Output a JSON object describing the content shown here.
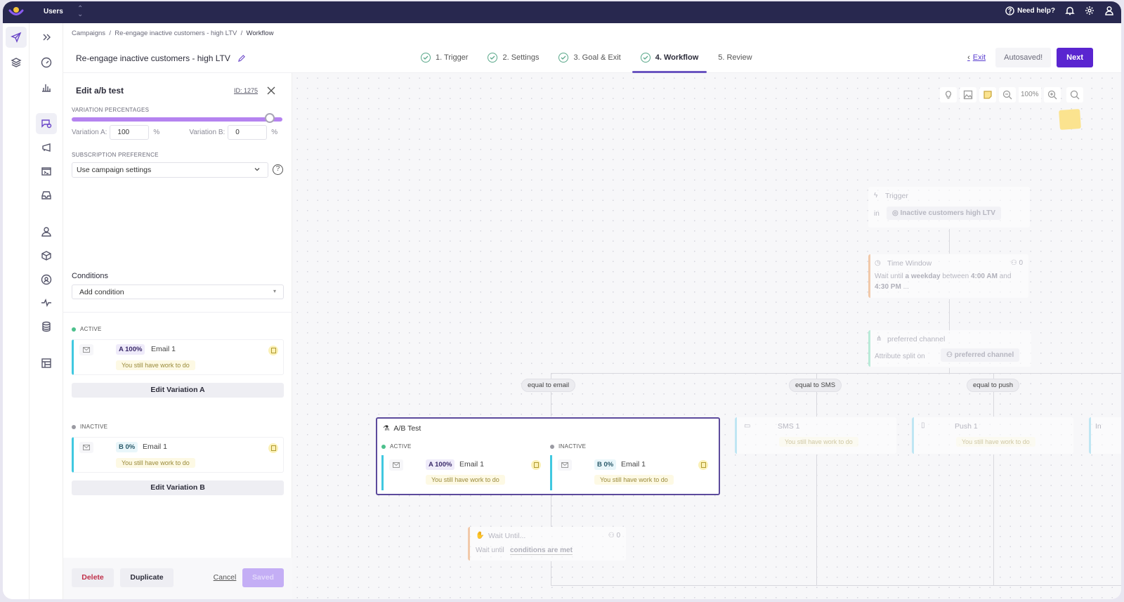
{
  "topbar": {
    "app_name": "Users",
    "help_label": "Need help?",
    "icons": [
      "help-circle-icon",
      "bell-icon",
      "gear-icon",
      "user-icon"
    ]
  },
  "rail_primary": [
    {
      "icon": "paper-plane-icon",
      "active": true
    },
    {
      "icon": "layers-icon",
      "active": false
    }
  ],
  "rail_secondary": [
    {
      "icon": "double-chevron-right-icon"
    },
    {
      "icon": "gauge-icon"
    },
    {
      "icon": "bar-chart-icon"
    },
    {
      "icon": "campaign-chat-icon",
      "active": true
    },
    {
      "icon": "megaphone-icon"
    },
    {
      "icon": "terminal-icon"
    },
    {
      "icon": "inbox-icon"
    },
    {
      "icon": "person-icon"
    },
    {
      "icon": "cube-icon"
    },
    {
      "icon": "user-circle-icon"
    },
    {
      "icon": "activity-icon"
    },
    {
      "icon": "database-icon"
    },
    {
      "icon": "table-layout-icon"
    }
  ],
  "breadcrumb": [
    "Campaigns",
    "Re-engage inactive customers - high LTV",
    "Workflow"
  ],
  "header": {
    "title": "Re-engage inactive customers - high LTV",
    "steps": [
      {
        "label": "1. Trigger",
        "done": true
      },
      {
        "label": "2. Settings",
        "done": true
      },
      {
        "label": "3. Goal & Exit",
        "done": true
      },
      {
        "label": "4. Workflow",
        "done": true,
        "active": true
      },
      {
        "label": "5. Review",
        "done": false
      }
    ],
    "exit_label": "Exit",
    "autosaved_label": "Autosaved!",
    "next_label": "Next"
  },
  "panel": {
    "title": "Edit a/b test",
    "id_label": "ID: 1275",
    "variation_percentages_label": "VARIATION PERCENTAGES",
    "slider_value_a_percent": 100,
    "variation_a_label": "Variation A:",
    "variation_a_value": "100",
    "variation_b_label": "Variation B:",
    "variation_b_value": "0",
    "percent_sign": "%",
    "subscription_label": "SUBSCRIPTION PREFERENCE",
    "subscription_value": "Use campaign settings",
    "conditions_label": "Conditions",
    "add_condition_placeholder": "Add condition",
    "active": {
      "state_label": "ACTIVE",
      "badge": "A 100%",
      "name": "Email 1",
      "status": "You still have work to do",
      "edit_label": "Edit Variation A"
    },
    "inactive": {
      "state_label": "INACTIVE",
      "badge": "B 0%",
      "name": "Email 1",
      "status": "You still have work to do",
      "edit_label": "Edit Variation B"
    },
    "footer": {
      "delete_label": "Delete",
      "duplicate_label": "Duplicate",
      "cancel_label": "Cancel",
      "saved_label": "Saved"
    }
  },
  "canvas": {
    "zoom_label": "100%",
    "trigger": {
      "title": "Trigger",
      "prefix": "in",
      "segment": "Inactive customers high LTV"
    },
    "time_window": {
      "title": "Time Window",
      "count": "0",
      "text_1": "Wait until",
      "bold_1": "a weekday",
      "text_2": "between",
      "bold_2": "4:00 AM",
      "text_3": "and",
      "bold_3": "4:30 PM",
      "ellipsis": "..."
    },
    "split": {
      "title": "preferred channel",
      "prefix": "Attribute split on",
      "attribute": "preferred channel"
    },
    "branches": [
      "equal to email",
      "equal to SMS",
      "equal to push"
    ],
    "ab_test": {
      "title": "A/B Test",
      "active": {
        "state": "ACTIVE",
        "badge": "A 100%",
        "name": "Email 1",
        "status": "You still have work to do"
      },
      "inactive": {
        "state": "INACTIVE",
        "badge": "B 0%",
        "name": "Email 1",
        "status": "You still have work to do"
      }
    },
    "sms": {
      "name": "SMS 1",
      "status": "You still have work to do"
    },
    "push": {
      "name": "Push 1",
      "status": "You still have work to do"
    },
    "partial_node_label": "In",
    "wait_until": {
      "title": "Wait Until...",
      "count": "0",
      "prefix": "Wait until",
      "condition": "conditions are met"
    }
  }
}
